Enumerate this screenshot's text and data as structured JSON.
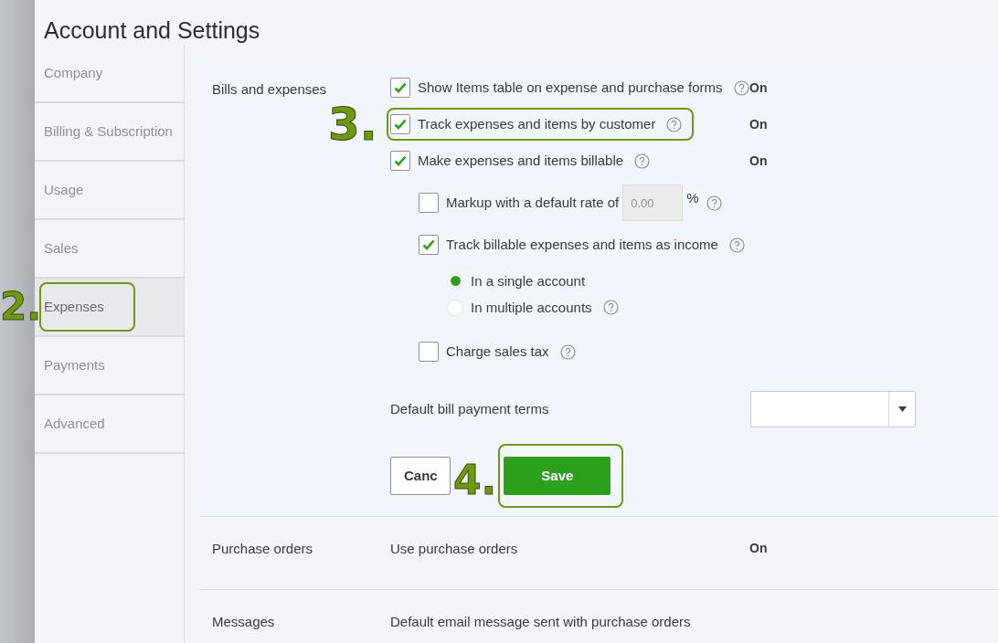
{
  "title": "Account and Settings",
  "sidebar": {
    "items": [
      {
        "label": "Company",
        "selected": false
      },
      {
        "label": "Billing & Subscription",
        "selected": false
      },
      {
        "label": "Usage",
        "selected": false
      },
      {
        "label": "Sales",
        "selected": false
      },
      {
        "label": "Expenses",
        "selected": true,
        "callout": "2."
      },
      {
        "label": "Payments",
        "selected": false
      },
      {
        "label": "Advanced",
        "selected": false
      }
    ]
  },
  "bills": {
    "title": "Bills and expenses",
    "options": [
      {
        "kind": "checkbox",
        "label": "Show Items table on expense and purchase forms",
        "checked": true,
        "help": true,
        "status": "On"
      },
      {
        "kind": "checkbox",
        "label": "Track expenses and items by customer",
        "checked": true,
        "help": true,
        "status": "On",
        "callout": "3."
      },
      {
        "kind": "checkbox",
        "label": "Make expenses and items billable",
        "checked": true,
        "help": true,
        "status": "On",
        "children": [
          {
            "kind": "rate",
            "label": "Markup with a default rate of",
            "checked": false,
            "value": "0.00",
            "unit": "%",
            "help": true
          },
          {
            "kind": "checkbox",
            "label": "Track billable expenses and items as income",
            "checked": true,
            "help": true,
            "children": [
              {
                "kind": "radio",
                "label": "In a single account",
                "selected": true
              },
              {
                "kind": "radio",
                "label": "In multiple accounts",
                "selected": false,
                "help": true
              }
            ]
          },
          {
            "kind": "checkbox",
            "label": "Charge sales tax",
            "checked": false,
            "help": true
          }
        ]
      }
    ],
    "terms": {
      "label": "Default bill payment terms"
    },
    "cancel": {
      "label": "Canc"
    },
    "save": {
      "label": "Save",
      "callout": "4."
    }
  },
  "rows": [
    {
      "title": "Purchase orders",
      "summary": "Use purchase orders",
      "status": "On"
    },
    {
      "title": "Messages",
      "summary": "Default email message sent with purchase orders"
    }
  ]
}
